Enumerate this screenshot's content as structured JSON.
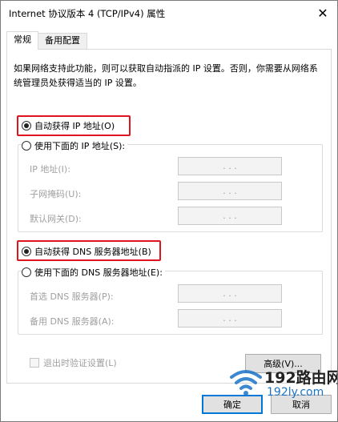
{
  "window": {
    "title": "Internet 协议版本 4 (TCP/IPv4) 属性",
    "close_glyph": "✕"
  },
  "tabs": [
    {
      "label": "常规",
      "active": true
    },
    {
      "label": "备用配置",
      "active": false
    }
  ],
  "general": {
    "description": "如果网络支持此功能，则可以获取自动指派的 IP 设置。否则，你需要从网络系统管理员处获得适当的 IP 设置。",
    "ip": {
      "auto_label": "自动获得 IP 地址(O)",
      "auto_selected": true,
      "manual_label": "使用下面的 IP 地址(S):",
      "fields": [
        {
          "label": "IP 地址(I):",
          "value": ".   .   ."
        },
        {
          "label": "子网掩码(U):",
          "value": ".   .   ."
        },
        {
          "label": "默认网关(D):",
          "value": ".   .   ."
        }
      ]
    },
    "dns": {
      "auto_label": "自动获得 DNS 服务器地址(B)",
      "auto_selected": true,
      "manual_label": "使用下面的 DNS 服务器地址(E):",
      "fields": [
        {
          "label": "首选 DNS 服务器(P):",
          "value": ".   .   ."
        },
        {
          "label": "备用 DNS 服务器(A):",
          "value": ".   .   ."
        }
      ]
    },
    "validate_label": "退出时验证设置(L)",
    "validate_checked": false,
    "advanced_label": "高级(V)..."
  },
  "buttons": {
    "ok": "确定",
    "cancel": "取消"
  },
  "watermark": {
    "brand": "192路由网",
    "url": "192ly.com",
    "prefix": "192"
  },
  "colors": {
    "highlight": "#e0141e",
    "default_button_border": "#0078d7",
    "watermark_blue": "#1a73c8"
  }
}
